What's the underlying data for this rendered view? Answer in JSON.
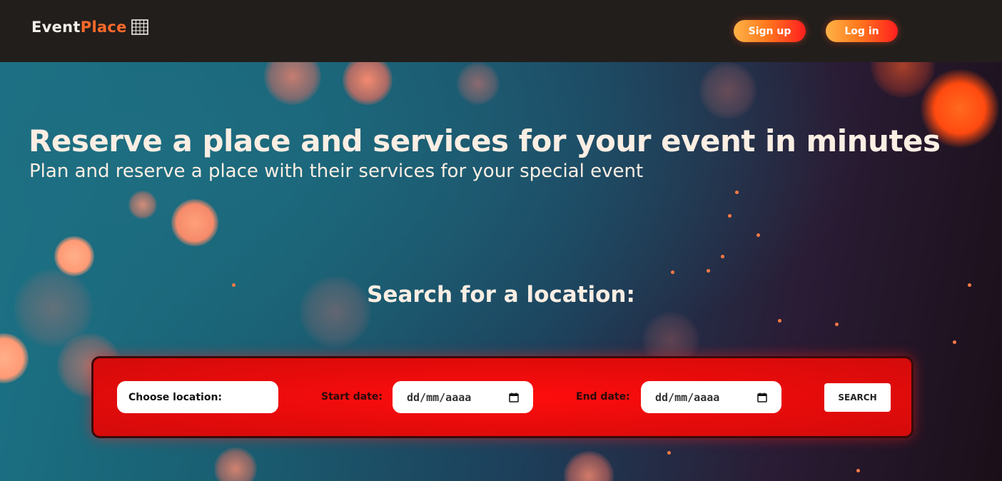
{
  "header": {
    "logo_part1": "Event",
    "logo_part2": "Place",
    "signup_label": "Sign up",
    "login_label": "Log in"
  },
  "hero": {
    "title": "Reserve a place and services for your event in minutes",
    "subtitle": "Plan and reserve a place with their services for your special event",
    "search_heading": "Search for a location:"
  },
  "search": {
    "location_placeholder": "Choose location:",
    "start_label": "Start date:",
    "start_value": "dd/mm/aaaa",
    "end_label": "End date:",
    "end_value": "dd/mm/aaaa",
    "search_button": "SEARCH"
  },
  "icons": {
    "logo_icon": "building-icon",
    "calendar_icon": "calendar-icon"
  },
  "colors": {
    "header_bg": "#221e1c",
    "accent_orange": "#ff6a2a",
    "search_bar_red": "#e80b0b",
    "text_light": "#fbeee3"
  }
}
